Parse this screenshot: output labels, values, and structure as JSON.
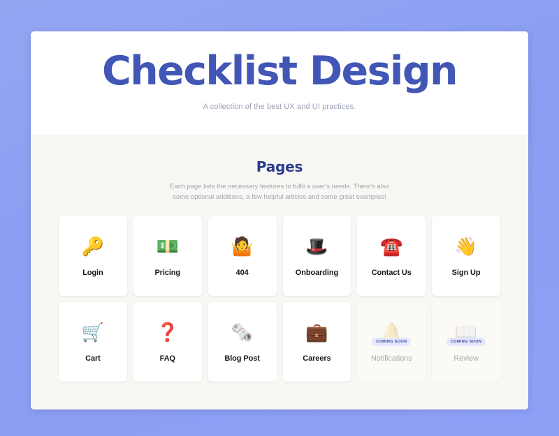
{
  "hero": {
    "title": "Checklist Design",
    "subtitle": "A collection of the best UX and UI practices.",
    "title_color": "#4156b5"
  },
  "pages_section": {
    "title": "Pages",
    "title_color": "#283a8f",
    "description": "Each page lists the necessary features to fulfil a user's needs. There's also some optional additions, a few helpful articles and some great examples!",
    "badge_label": "COMING SOON",
    "cards": [
      {
        "label": "Login",
        "icon": "key-icon",
        "emoji": "🔑",
        "disabled": false
      },
      {
        "label": "Pricing",
        "icon": "money-banknote-icon",
        "emoji": "💵",
        "disabled": false
      },
      {
        "label": "404",
        "icon": "shrug-icon",
        "emoji": "🤷",
        "disabled": false
      },
      {
        "label": "Onboarding",
        "icon": "top-hat-icon",
        "emoji": "🎩",
        "disabled": false
      },
      {
        "label": "Contact Us",
        "icon": "telephone-icon",
        "emoji": "☎️",
        "disabled": false
      },
      {
        "label": "Sign Up",
        "icon": "waving-hand-icon",
        "emoji": "👋",
        "disabled": false
      },
      {
        "label": "Cart",
        "icon": "shopping-cart-icon",
        "emoji": "🛒",
        "disabled": false
      },
      {
        "label": "FAQ",
        "icon": "question-mark-icon",
        "emoji": "❓",
        "disabled": false
      },
      {
        "label": "Blog Post",
        "icon": "rolled-newspaper-icon",
        "emoji": "🗞️",
        "disabled": false
      },
      {
        "label": "Careers",
        "icon": "briefcase-icon",
        "emoji": "💼",
        "disabled": false
      },
      {
        "label": "Notifications",
        "icon": "bell-icon",
        "emoji": "🔔",
        "disabled": true
      },
      {
        "label": "Review",
        "icon": "open-book-icon",
        "emoji": "📖",
        "disabled": true
      }
    ]
  },
  "theme": {
    "page_background": "#8b9df2",
    "panel_background": "#ffffff",
    "section_background": "#f8f7f3",
    "badge_background": "#e6e7fb",
    "badge_text_color": "#3b46a8"
  }
}
